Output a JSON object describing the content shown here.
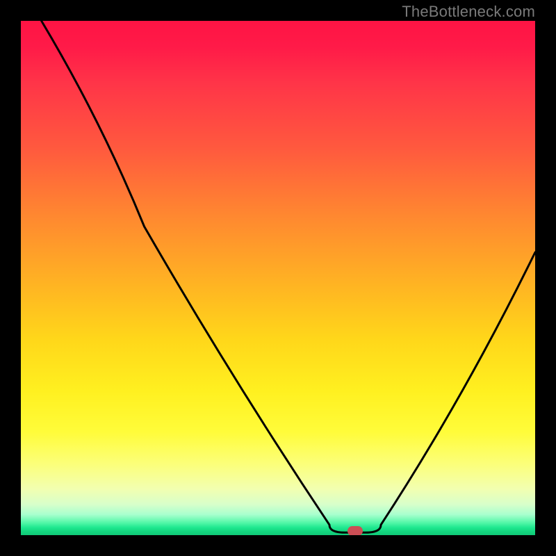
{
  "watermark": "TheBottleneck.com",
  "chart_data": {
    "type": "line",
    "title": "",
    "xlabel": "",
    "ylabel": "",
    "xlim": [
      0,
      100
    ],
    "ylim": [
      0,
      100
    ],
    "curve": [
      {
        "x": 4,
        "y": 100
      },
      {
        "x": 24,
        "y": 60
      },
      {
        "x": 60,
        "y": 2
      },
      {
        "x": 63,
        "y": 0.5
      },
      {
        "x": 67,
        "y": 0.5
      },
      {
        "x": 70,
        "y": 2
      },
      {
        "x": 100,
        "y": 55
      }
    ],
    "marker": {
      "x": 65,
      "y": 0.8
    },
    "gradient_colors": {
      "top": "#ff1444",
      "mid": "#ffd71a",
      "bottom": "#10c878"
    }
  }
}
